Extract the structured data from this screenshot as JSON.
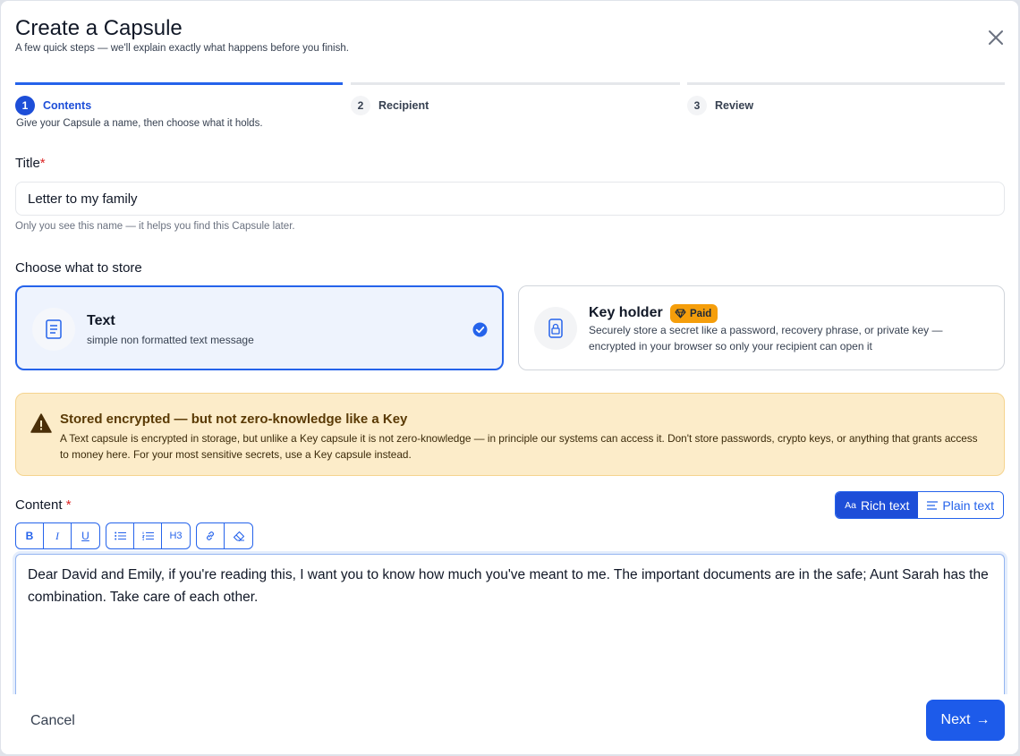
{
  "dialog": {
    "title": "Create a Capsule",
    "subtitle": "A few quick steps — we'll explain exactly what happens before you finish."
  },
  "steps": [
    {
      "number": "1",
      "label": "Contents",
      "description": "Give your Capsule a name, then choose what it holds.",
      "active": true
    },
    {
      "number": "2",
      "label": "Recipient",
      "active": false
    },
    {
      "number": "3",
      "label": "Review",
      "active": false
    }
  ],
  "title_field": {
    "label": "Title",
    "required_mark": "*",
    "value": "Letter to my family",
    "help": "Only you see this name — it helps you find this Capsule later."
  },
  "store": {
    "label": "Choose what to store",
    "options": [
      {
        "title": "Text",
        "description": "simple non formatted text message",
        "icon": "document-icon",
        "selected": true
      },
      {
        "title": "Key holder",
        "badge": "Paid",
        "badge_icon": "gem-icon",
        "description": "Securely store a secret like a password, recovery phrase, or private key — encrypted in your browser so only your recipient can open it",
        "icon": "lock-icon",
        "selected": false
      }
    ]
  },
  "warning": {
    "icon": "warning-icon",
    "title": "Stored encrypted — but not zero-knowledge like a Key",
    "body": "A Text capsule is encrypted in storage, but unlike a Key capsule it is not zero-knowledge — in principle our systems can access it. Don't store passwords, crypto keys, or anything that grants access to money here. For your most sensitive secrets, use a Key capsule instead."
  },
  "content": {
    "label": "Content",
    "required_mark": "*",
    "mode_rich": "Rich text",
    "mode_rich_icon_text": "Aa",
    "mode_plain": "Plain text",
    "active_mode": "rich",
    "toolbar": {
      "bold": "B",
      "italic": "I",
      "underline": "U",
      "heading": "H3"
    },
    "text": "Dear David and Emily, if you're reading this, I want you to know how much you've meant to me. The important documents are in the safe; Aunt Sarah has the combination. Take care of each other."
  },
  "footer": {
    "cancel": "Cancel",
    "next": "Next",
    "next_icon": "→"
  },
  "colors": {
    "accent": "#1d4ed8",
    "warning_bg": "#fcecc9",
    "paid_badge": "#f59e0b",
    "required": "#dc2626"
  }
}
